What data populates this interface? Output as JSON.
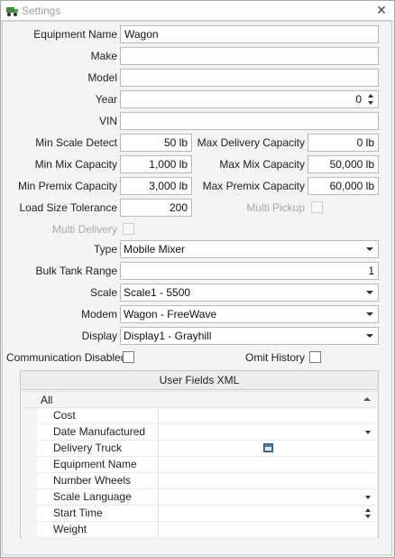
{
  "window": {
    "title": "Settings",
    "close_glyph": "✕",
    "icon": "truck-icon"
  },
  "form": {
    "equipment_name": {
      "label": "Equipment Name",
      "value": "Wagon"
    },
    "make": {
      "label": "Make",
      "value": ""
    },
    "model": {
      "label": "Model",
      "value": ""
    },
    "year": {
      "label": "Year",
      "value": "0"
    },
    "vin": {
      "label": "VIN",
      "value": ""
    },
    "min_scale_detect": {
      "label": "Min Scale Detect",
      "value": "50 lb"
    },
    "max_delivery_capacity": {
      "label": "Max Delivery Capacity",
      "value": "0 lb"
    },
    "min_mix_capacity": {
      "label": "Min Mix Capacity",
      "value": "1,000 lb"
    },
    "max_mix_capacity": {
      "label": "Max Mix Capacity",
      "value": "50,000 lb"
    },
    "min_premix_capacity": {
      "label": "Min Premix Capacity",
      "value": "3,000 lb"
    },
    "max_premix_capacity": {
      "label": "Max Premix Capacity",
      "value": "60,000 lb"
    },
    "load_size_tolerance": {
      "label": "Load Size Tolerance",
      "value": "200"
    },
    "multi_pickup": {
      "label": "Multi Pickup",
      "checked": false,
      "enabled": false
    },
    "multi_delivery": {
      "label": "Multi Delivery",
      "checked": false,
      "enabled": false
    },
    "type": {
      "label": "Type",
      "value": "Mobile Mixer"
    },
    "bulk_tank_range": {
      "label": "Bulk Tank Range",
      "value": "1"
    },
    "scale": {
      "label": "Scale",
      "value": "Scale1 - 5500"
    },
    "modem": {
      "label": "Modem",
      "value": "Wagon - FreeWave"
    },
    "display": {
      "label": "Display",
      "value": "Display1 - Grayhill"
    },
    "communication_disabled": {
      "label": "Communication Disabled",
      "checked": false
    },
    "omit_history": {
      "label": "Omit History",
      "checked": false
    }
  },
  "user_fields": {
    "header": "User Fields XML",
    "category": "All",
    "rows": [
      {
        "name": "Cost",
        "editor": "text"
      },
      {
        "name": "Date Manufactured",
        "editor": "dropdown"
      },
      {
        "name": "Delivery Truck",
        "editor": "checkbox"
      },
      {
        "name": "Equipment Name",
        "editor": "text"
      },
      {
        "name": "Number Wheels",
        "editor": "text"
      },
      {
        "name": "Scale Language",
        "editor": "dropdown"
      },
      {
        "name": "Start Time",
        "editor": "spin"
      },
      {
        "name": "Weight",
        "editor": "text"
      }
    ]
  }
}
